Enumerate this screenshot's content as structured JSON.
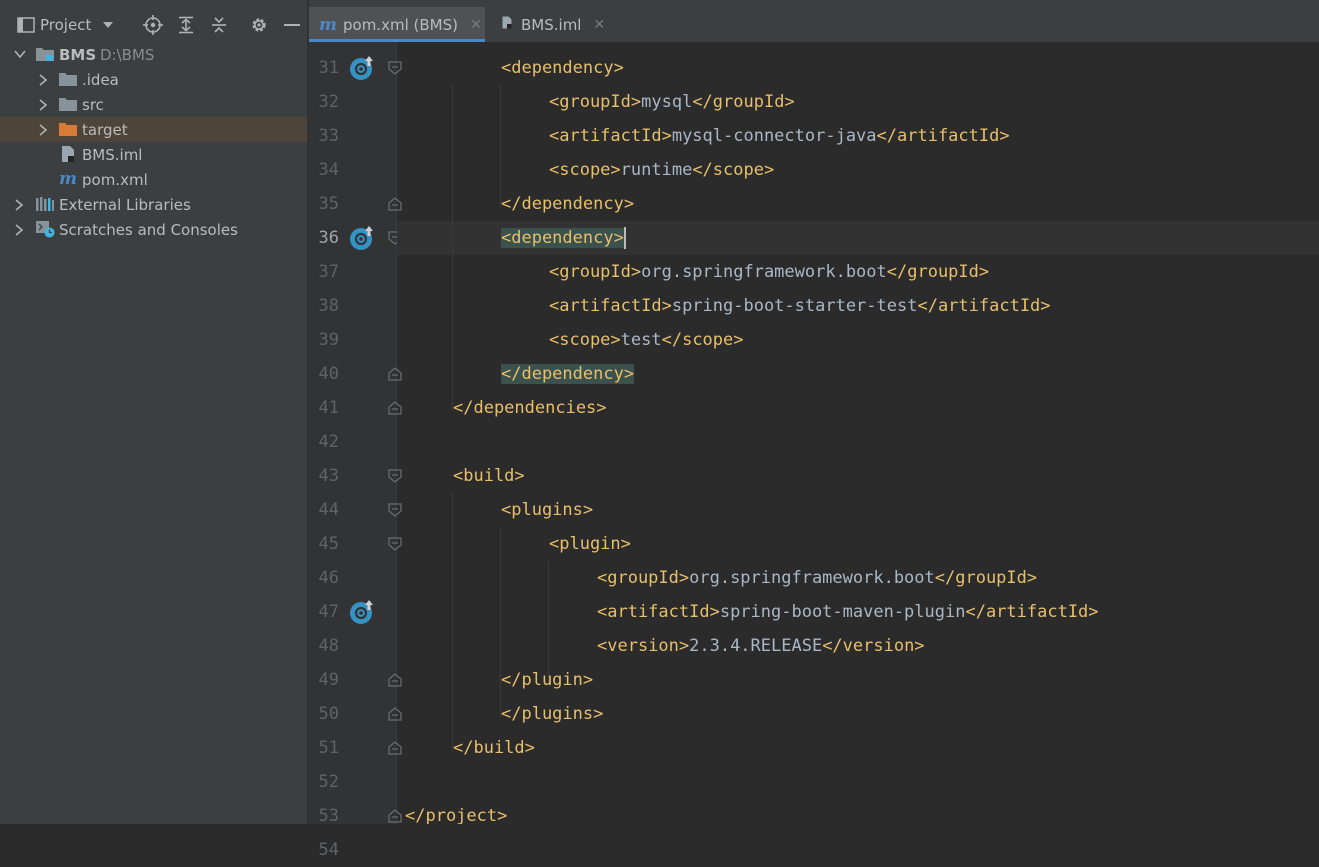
{
  "project_panel": {
    "title": "Project",
    "tree": [
      {
        "label": "BMS",
        "path": "D:\\BMS",
        "icon": "module-folder-icon",
        "expanded": true
      },
      {
        "label": ".idea",
        "icon": "folder-icon",
        "expanded": false
      },
      {
        "label": "src",
        "icon": "folder-icon",
        "expanded": false
      },
      {
        "label": "target",
        "icon": "excluded-folder-icon",
        "expanded": false,
        "selected": true
      },
      {
        "label": "BMS.iml",
        "icon": "iml-file-icon"
      },
      {
        "label": "pom.xml",
        "icon": "maven-file-icon"
      },
      {
        "label": "External Libraries",
        "icon": "libraries-icon",
        "expanded": false
      },
      {
        "label": "Scratches and Consoles",
        "icon": "scratches-icon",
        "expanded": false
      }
    ]
  },
  "tabs": [
    {
      "label": "pom.xml (BMS)",
      "icon": "maven-file-icon",
      "active": true
    },
    {
      "label": "BMS.iml",
      "icon": "iml-file-icon",
      "active": false
    }
  ],
  "editor": {
    "current_line": "36",
    "lines": [
      {
        "num": "31",
        "indent": 4,
        "segs": [
          [
            "tag",
            "<dependency>"
          ]
        ]
      },
      {
        "num": "32",
        "indent": 6,
        "segs": [
          [
            "tag",
            "<groupId>"
          ],
          [
            "txt",
            "mysql"
          ],
          [
            "tag",
            "</groupId>"
          ]
        ]
      },
      {
        "num": "33",
        "indent": 6,
        "segs": [
          [
            "tag",
            "<artifactId>"
          ],
          [
            "txt",
            "mysql-connector-java"
          ],
          [
            "tag",
            "</artifactId>"
          ]
        ]
      },
      {
        "num": "34",
        "indent": 6,
        "segs": [
          [
            "tag",
            "<scope>"
          ],
          [
            "txt",
            "runtime"
          ],
          [
            "tag",
            "</scope>"
          ]
        ]
      },
      {
        "num": "35",
        "indent": 4,
        "segs": [
          [
            "tag",
            "</dependency>"
          ]
        ]
      },
      {
        "num": "36",
        "indent": 4,
        "segs": [
          [
            "taghl",
            "<dependency>"
          ],
          [
            "caret",
            ""
          ]
        ]
      },
      {
        "num": "37",
        "indent": 6,
        "segs": [
          [
            "tag",
            "<groupId>"
          ],
          [
            "txt",
            "org.springframework.boot"
          ],
          [
            "tag",
            "</groupId>"
          ]
        ]
      },
      {
        "num": "38",
        "indent": 6,
        "segs": [
          [
            "tag",
            "<artifactId>"
          ],
          [
            "txt",
            "spring-boot-starter-test"
          ],
          [
            "tag",
            "</artifactId>"
          ]
        ]
      },
      {
        "num": "39",
        "indent": 6,
        "segs": [
          [
            "tag",
            "<scope>"
          ],
          [
            "txt",
            "test"
          ],
          [
            "tag",
            "</scope>"
          ]
        ]
      },
      {
        "num": "40",
        "indent": 4,
        "segs": [
          [
            "taghl",
            "</dependency>"
          ]
        ]
      },
      {
        "num": "41",
        "indent": 2,
        "segs": [
          [
            "tag",
            "</dependencies>"
          ]
        ]
      },
      {
        "num": "42",
        "indent": 0,
        "segs": []
      },
      {
        "num": "43",
        "indent": 2,
        "segs": [
          [
            "tag",
            "<build>"
          ]
        ]
      },
      {
        "num": "44",
        "indent": 4,
        "segs": [
          [
            "tag",
            "<plugins>"
          ]
        ]
      },
      {
        "num": "45",
        "indent": 6,
        "segs": [
          [
            "tag",
            "<plugin>"
          ]
        ]
      },
      {
        "num": "46",
        "indent": 8,
        "segs": [
          [
            "tag",
            "<groupId>"
          ],
          [
            "txt",
            "org.springframework.boot"
          ],
          [
            "tag",
            "</groupId>"
          ]
        ]
      },
      {
        "num": "47",
        "indent": 8,
        "segs": [
          [
            "tag",
            "<artifactId>"
          ],
          [
            "txt",
            "spring-boot-maven-plugin"
          ],
          [
            "tag",
            "</artifactId>"
          ]
        ]
      },
      {
        "num": "48",
        "indent": 8,
        "segs": [
          [
            "tag",
            "<version>"
          ],
          [
            "txt",
            "2.3.4.RELEASE"
          ],
          [
            "tag",
            "</version>"
          ]
        ]
      },
      {
        "num": "49",
        "indent": 4,
        "segs": [
          [
            "tag",
            "</plugin>"
          ]
        ]
      },
      {
        "num": "50",
        "indent": 4,
        "segs": [
          [
            "tag",
            "</plugins>"
          ]
        ]
      },
      {
        "num": "51",
        "indent": 2,
        "segs": [
          [
            "tag",
            "</build>"
          ]
        ]
      },
      {
        "num": "52",
        "indent": 0,
        "segs": []
      },
      {
        "num": "53",
        "indent": 0,
        "segs": [
          [
            "tag",
            "</project>"
          ]
        ]
      },
      {
        "num": "54",
        "indent": 0,
        "segs": []
      }
    ]
  },
  "colors": {
    "tag": "#e8bf6a",
    "text": "#a9b7c6",
    "background": "#2b2b2b",
    "panel": "#3c3f41",
    "match_highlight": "#3b514d"
  }
}
